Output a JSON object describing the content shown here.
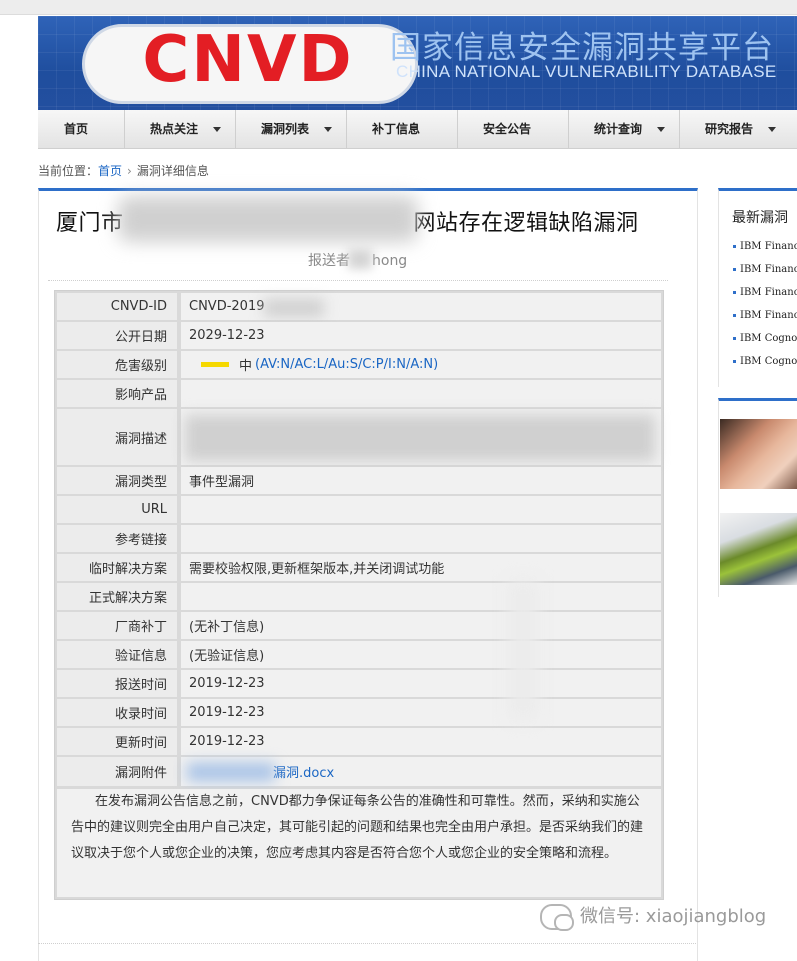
{
  "header": {
    "logo_text": "CNVD",
    "cn_title": "国家信息安全漏洞共享平台",
    "en_title": "CHINA NATIONAL VULNERABILITY DATABASE"
  },
  "nav": {
    "items": [
      {
        "label": "首页",
        "dropdown": false
      },
      {
        "label": "热点关注",
        "dropdown": true
      },
      {
        "label": "漏洞列表",
        "dropdown": true
      },
      {
        "label": "补丁信息",
        "dropdown": false
      },
      {
        "label": "安全公告",
        "dropdown": false
      },
      {
        "label": "统计查询",
        "dropdown": true
      },
      {
        "label": "研究报告",
        "dropdown": true
      }
    ]
  },
  "breadcrumb": {
    "prefix": "当前位置：",
    "home": "首页",
    "current": "漏洞详细信息"
  },
  "article": {
    "title_prefix": "厦门市",
    "title_suffix": "网站存在逻辑缺陷漏洞",
    "reporter_prefix": "报送者",
    "reporter_suffix": "hong"
  },
  "fields": {
    "cnvd_id_label": "CNVD-ID",
    "cnvd_id_value": "CNVD-2019",
    "publish_label": "公开日期",
    "publish_value": "2029-12-23",
    "severity_label": "危害级别",
    "severity_level": "中",
    "severity_vector": "(AV:N/AC:L/Au:S/C:P/I:N/A:N)",
    "product_label": "影响产品",
    "desc_label": "漏洞描述",
    "type_label": "漏洞类型",
    "type_value": "事件型漏洞",
    "url_label": "URL",
    "ref_label": "参考链接",
    "temp_fix_label": "临时解决方案",
    "temp_fix_value": "需要校验权限,更新框架版本,并关闭调试功能",
    "formal_fix_label": "正式解决方案",
    "patch_label": "厂商补丁",
    "patch_value": "(无补丁信息)",
    "verify_label": "验证信息",
    "verify_value": "(无验证信息)",
    "report_time_label": "报送时间",
    "report_time_value": "2019-12-23",
    "collect_time_label": "收录时间",
    "collect_time_value": "2019-12-23",
    "update_time_label": "更新时间",
    "update_time_value": "2019-12-23",
    "attachment_label": "漏洞附件",
    "attachment_value": "漏洞.docx"
  },
  "disclaimer": "在发布漏洞公告信息之前，CNVD都力争保证每条公告的准确性和可靠性。然而，采纳和实施公告中的建议则完全由用户自己决定，其可能引起的问题和结果也完全由用户承担。是否采纳我们的建议取决于您个人或您企业的决策，您应考虑其内容是否符合您个人或您企业的安全策略和流程。",
  "sidebar": {
    "latest_title": "最新漏洞",
    "latest_items": [
      "IBM Financ",
      "IBM Financ",
      "IBM Financ",
      "IBM Financ",
      "IBM Cognos",
      "IBM Cognos"
    ]
  },
  "watermark": "微信号: xiaojiangblog",
  "colors": {
    "accent": "#2e6fc9",
    "severity_medium": "#f5d800",
    "link": "#1a66c4",
    "logo_red": "#e31e24"
  }
}
